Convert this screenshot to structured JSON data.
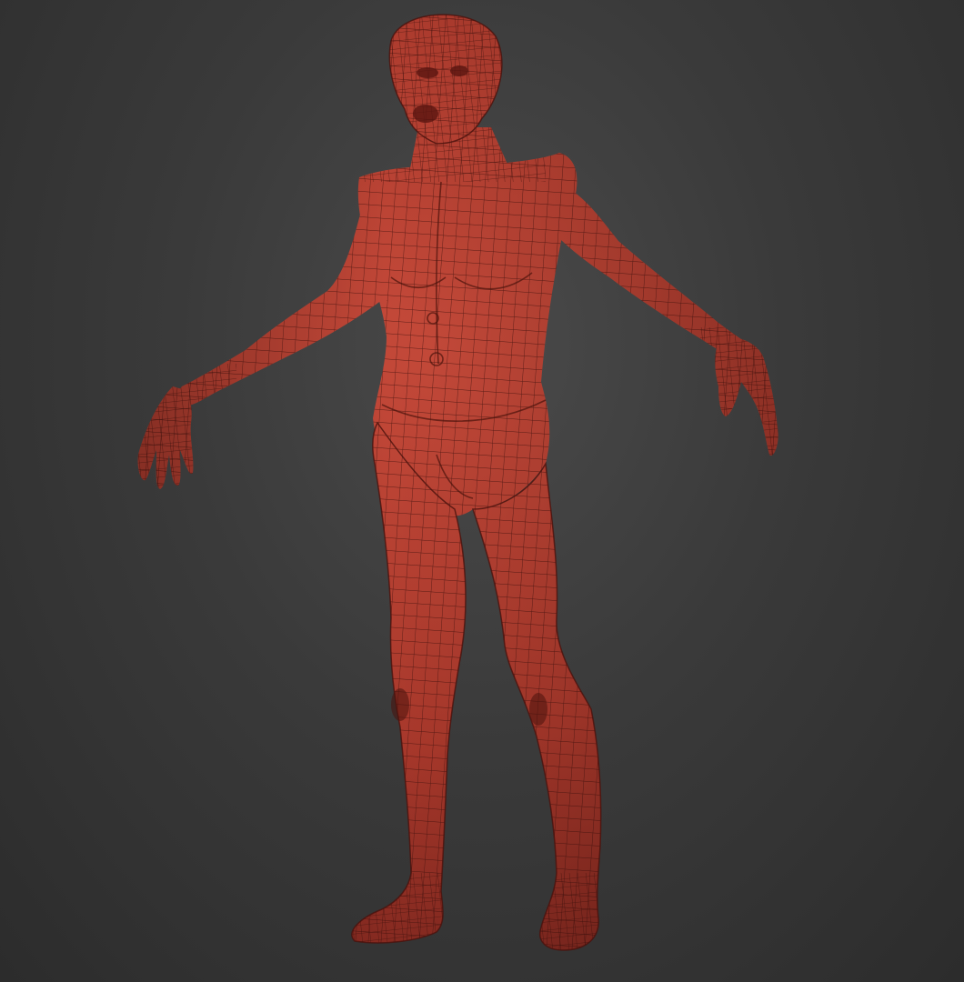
{
  "scene": {
    "background_color": "#3a3a3a",
    "mesh_color": "#b0382c",
    "wire_color": "#3a0f0a",
    "subject": "humanoid-wireframe-model"
  }
}
